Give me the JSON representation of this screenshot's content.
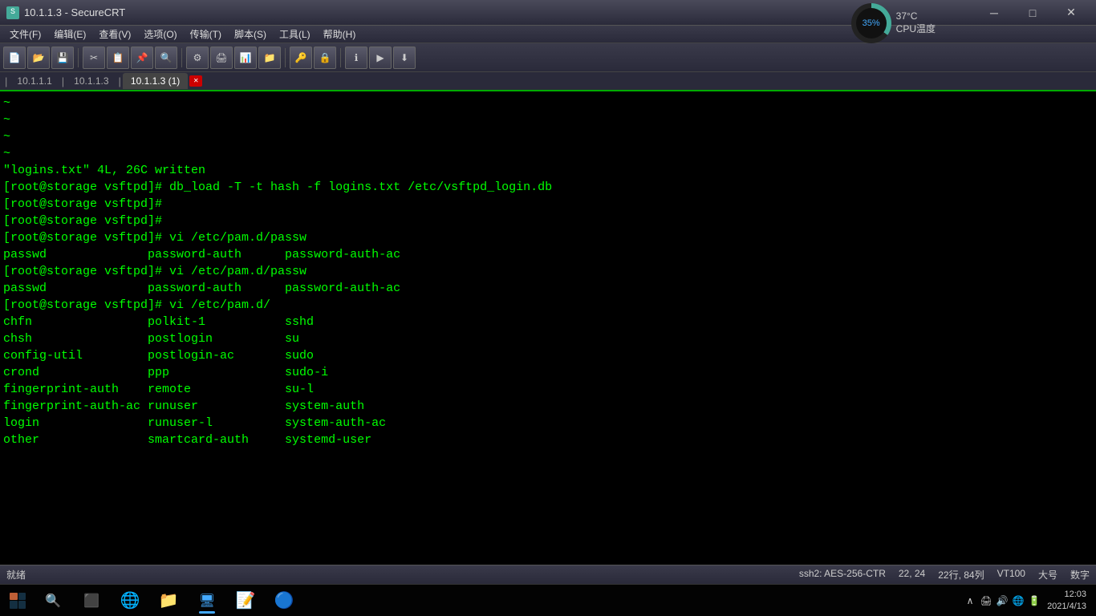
{
  "title_bar": {
    "title": "10.1.1.3 - SecureCRT",
    "minimize": "─",
    "maximize": "□",
    "close": "✕"
  },
  "cpu_widget": {
    "percent": "35%",
    "temp": "37°C",
    "label": "CPU温度"
  },
  "menu_bar": {
    "items": [
      "文件(F)",
      "编辑(E)",
      "查看(V)",
      "选项(O)",
      "传输(T)",
      "脚本(S)",
      "工具(L)",
      "帮助(H)"
    ]
  },
  "tabs": [
    {
      "label": "10.1.1.1",
      "active": false
    },
    {
      "label": "10.1.1.3",
      "active": false
    },
    {
      "label": "10.1.1.3 (1)",
      "active": true
    }
  ],
  "terminal": {
    "lines": [
      "~",
      "~",
      "~",
      "~",
      "\"logins.txt\" 4L, 26C written",
      "[root@storage vsftpd]# db_load -T -t hash -f logins.txt /etc/vsftpd_login.db",
      "[root@storage vsftpd]#",
      "[root@storage vsftpd]#",
      "[root@storage vsftpd]# vi /etc/pam.d/passw",
      "passwd              password-auth      password-auth-ac",
      "[root@storage vsftpd]# vi /etc/pam.d/passw",
      "passwd              password-auth      password-auth-ac",
      "[root@storage vsftpd]# vi /etc/pam.d/",
      "chfn                polkit-1           sshd",
      "chsh                postlogin          su",
      "config-util         postlogin-ac       sudo",
      "crond               ppp                sudo-i",
      "fingerprint-auth    remote             su-l",
      "fingerprint-auth-ac runuser            system-auth",
      "login               runuser-l          system-auth-ac",
      "other               smartcard-auth     systemd-user"
    ]
  },
  "status_bar": {
    "left": "就绪",
    "right": {
      "crypto": "ssh2: AES-256-CTR",
      "row": "22, 24",
      "lines": "22行, 84列",
      "term": "VT100",
      "size": "大号",
      "charset": "数字"
    }
  },
  "taskbar": {
    "time": "12:03",
    "date": "2021/4/13",
    "tray_icons": [
      "^",
      "🖨",
      "🔊",
      "📶",
      "🔋"
    ]
  }
}
